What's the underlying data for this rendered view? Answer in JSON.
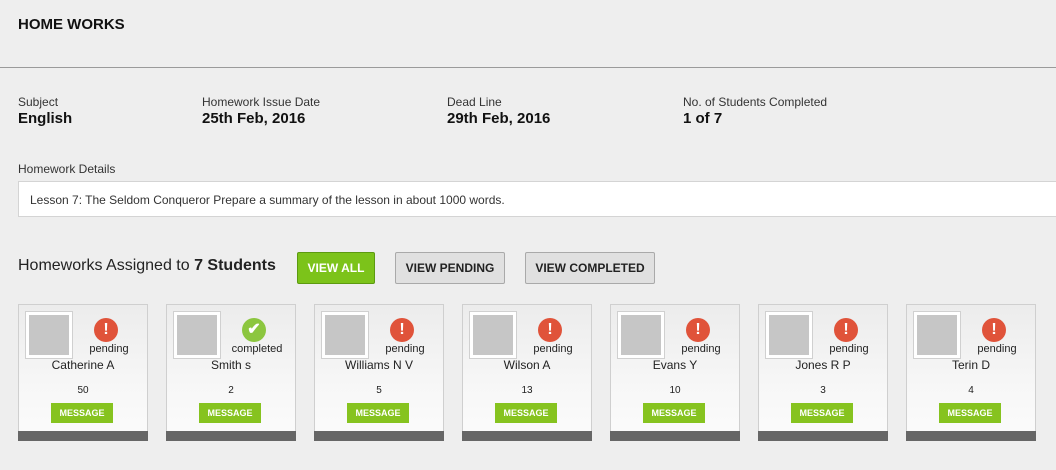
{
  "page_title": "HOME WORKS",
  "info": [
    {
      "label": "Subject",
      "value": "English"
    },
    {
      "label": "Homework Issue Date",
      "value": "25th Feb, 2016"
    },
    {
      "label": "Dead Line",
      "value": "29th Feb, 2016"
    },
    {
      "label": "No. of Students Completed",
      "value": "1 of 7"
    }
  ],
  "details": {
    "label": "Homework Details",
    "text": "Lesson 7: The Seldom Conqueror Prepare a summary of the lesson in about 1000 words."
  },
  "assigned": {
    "prefix": "Homeworks Assigned to ",
    "count": "7 Students"
  },
  "buttons": {
    "view_all": "VIEW ALL",
    "view_pending": "VIEW PENDING",
    "view_completed": "VIEW COMPLETED"
  },
  "colors": {
    "pending": "#e0533a",
    "completed": "#8cc63f",
    "accent": "#7cc31a"
  },
  "students": [
    {
      "name": "Catherine A",
      "status": "pending",
      "count": "50",
      "message": "MESSAGE"
    },
    {
      "name": "Smith s",
      "status": "completed",
      "count": "2",
      "message": "MESSAGE"
    },
    {
      "name": "Williams N V",
      "status": "pending",
      "count": "5",
      "message": "MESSAGE"
    },
    {
      "name": "Wilson A",
      "status": "pending",
      "count": "13",
      "message": "MESSAGE"
    },
    {
      "name": "Evans Y",
      "status": "pending",
      "count": "10",
      "message": "MESSAGE"
    },
    {
      "name": "Jones R P",
      "status": "pending",
      "count": "3",
      "message": "MESSAGE"
    },
    {
      "name": "Terin D",
      "status": "pending",
      "count": "4",
      "message": "MESSAGE"
    }
  ]
}
